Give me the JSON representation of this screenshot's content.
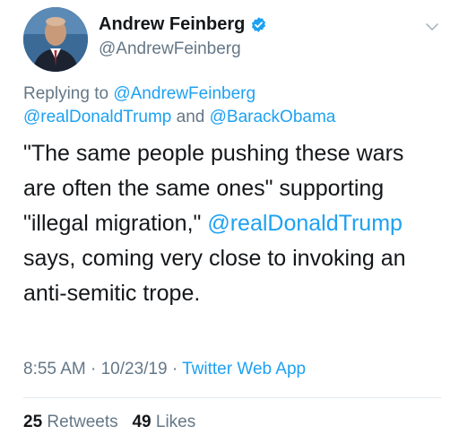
{
  "author": {
    "display_name": "Andrew Feinberg",
    "handle": "@AndrewFeinberg",
    "verified": true
  },
  "reply": {
    "prefix": "Replying to",
    "to_1": "@AndrewFeinberg",
    "to_2": "@realDonaldTrump",
    "joiner": "and",
    "to_3": "@BarackObama"
  },
  "body": {
    "line1": "\"The same people pushing these wars",
    "line2": "are often the same ones\" supporting",
    "line3_text": "\"illegal migration,\"",
    "line3_mention": "@realDonaldTrump",
    "line4": "says, coming very close to invoking an",
    "line5": "anti-semitic trope."
  },
  "meta": {
    "time": "8:55 AM",
    "sep1": "·",
    "date": "10/23/19",
    "sep2": "·",
    "source": "Twitter Web App"
  },
  "stats": {
    "retweets_count": "25",
    "retweets_label": "Retweets",
    "likes_count": "49",
    "likes_label": "Likes"
  },
  "colors": {
    "link": "#1da1f2",
    "secondary_text": "#657786",
    "primary_text": "#14171a",
    "verified_badge": "#1da1f2"
  },
  "icons": {
    "verified": "verified-badge-icon",
    "menu": "chevron-down-icon"
  }
}
